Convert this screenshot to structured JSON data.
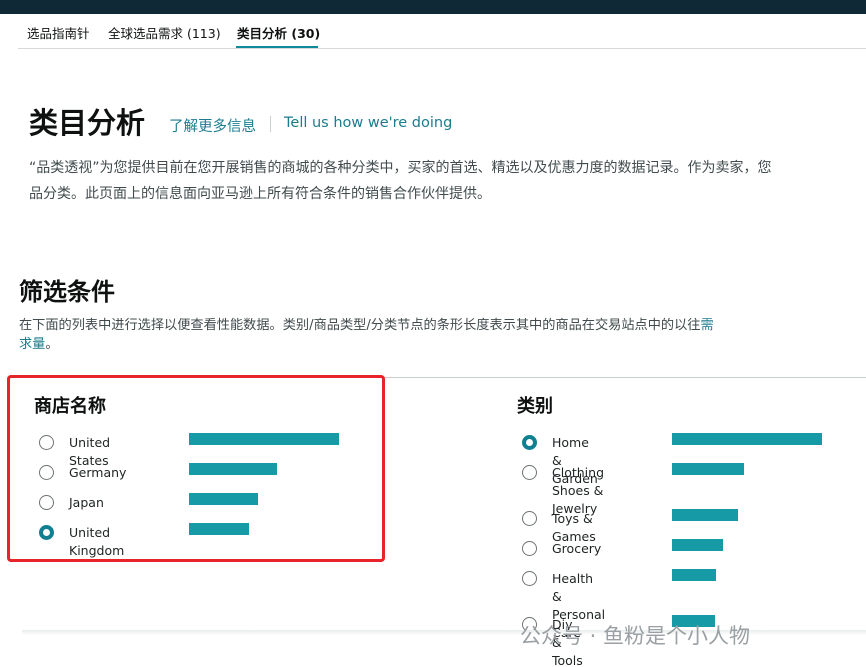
{
  "colors": {
    "topbar": "#0f2a36",
    "accent": "#0f8a9b",
    "bar": "#159aa6",
    "link": "#1b7c8e",
    "highlight": "#e8242a"
  },
  "tabs": [
    {
      "label": "选品指南针"
    },
    {
      "label": "全球选品需求 (113)"
    },
    {
      "label": "类目分析 (30)",
      "active": true
    }
  ],
  "header": {
    "title": "类目分析",
    "learn_more": "了解更多信息",
    "tell_us": "Tell us how we're doing"
  },
  "description": {
    "line1": "“品类透视”为您提供目前在您开展销售的商城的各种分类中，买家的首选、精选以及优惠力度的数据记录。作为卖家，您",
    "line2": "品分类。此页面上的信息面向亚马逊上所有符合条件的销售合作伙伴提供。"
  },
  "filters": {
    "title": "筛选条件",
    "desc_line1_text": "在下面的列表中进行选择以便查看性能数据。类别/商品类型/分类节点的条形长度表示其中的商品在交易站点中的以往",
    "desc_link_part1": "需",
    "desc_link_part2": "求量",
    "desc_end": "。"
  },
  "store_panel": {
    "title": "商店名称",
    "options": [
      {
        "label": "United States",
        "checked": false,
        "bar": 1.0
      },
      {
        "label": "Germany",
        "checked": false,
        "bar": 0.59
      },
      {
        "label": "Japan",
        "checked": false,
        "bar": 0.46
      },
      {
        "label": "United Kingdom",
        "checked": true,
        "bar": 0.4
      }
    ]
  },
  "category_panel": {
    "title": "类别",
    "options": [
      {
        "label": "Home & Garden",
        "checked": true,
        "bar": 1.0
      },
      {
        "label_line1": "Clothing Shoes &",
        "label_line2": "Jewelry",
        "checked": false,
        "bar": 0.48
      },
      {
        "label": "Toys & Games",
        "checked": false,
        "bar": 0.44
      },
      {
        "label": "Grocery",
        "checked": false,
        "bar": 0.34
      },
      {
        "label_line1": "Health & Personal",
        "label_line2": "Care",
        "checked": false,
        "bar": 0.29
      },
      {
        "label": "Diy & Tools",
        "checked": false,
        "bar": 0.29
      }
    ]
  },
  "watermark": "公众号 · 鱼粉是个小人物"
}
